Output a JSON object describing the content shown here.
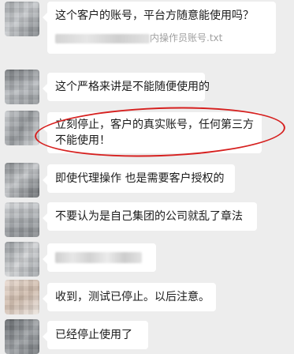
{
  "messages": [
    {
      "text": "这个客户的账号，平台方随意能使用吗？",
      "attachment": "内操作员账号.txt"
    },
    {
      "text": "这个严格来讲是不能随便使用的"
    },
    {
      "text": "立刻停止，客户的真实账号，任何第三方不能使用！"
    },
    {
      "text": "即使代理操作 也是需要客户授权的"
    },
    {
      "text": "不要认为是自己集团的公司就乱了章法"
    },
    {
      "text": ""
    },
    {
      "text": "收到，测试已停止。以后注意。"
    },
    {
      "text": "已经停止使用了"
    }
  ],
  "colors": {
    "background": "#ededed",
    "bubble": "#ffffff",
    "highlight_ellipse": "#d6201f"
  }
}
